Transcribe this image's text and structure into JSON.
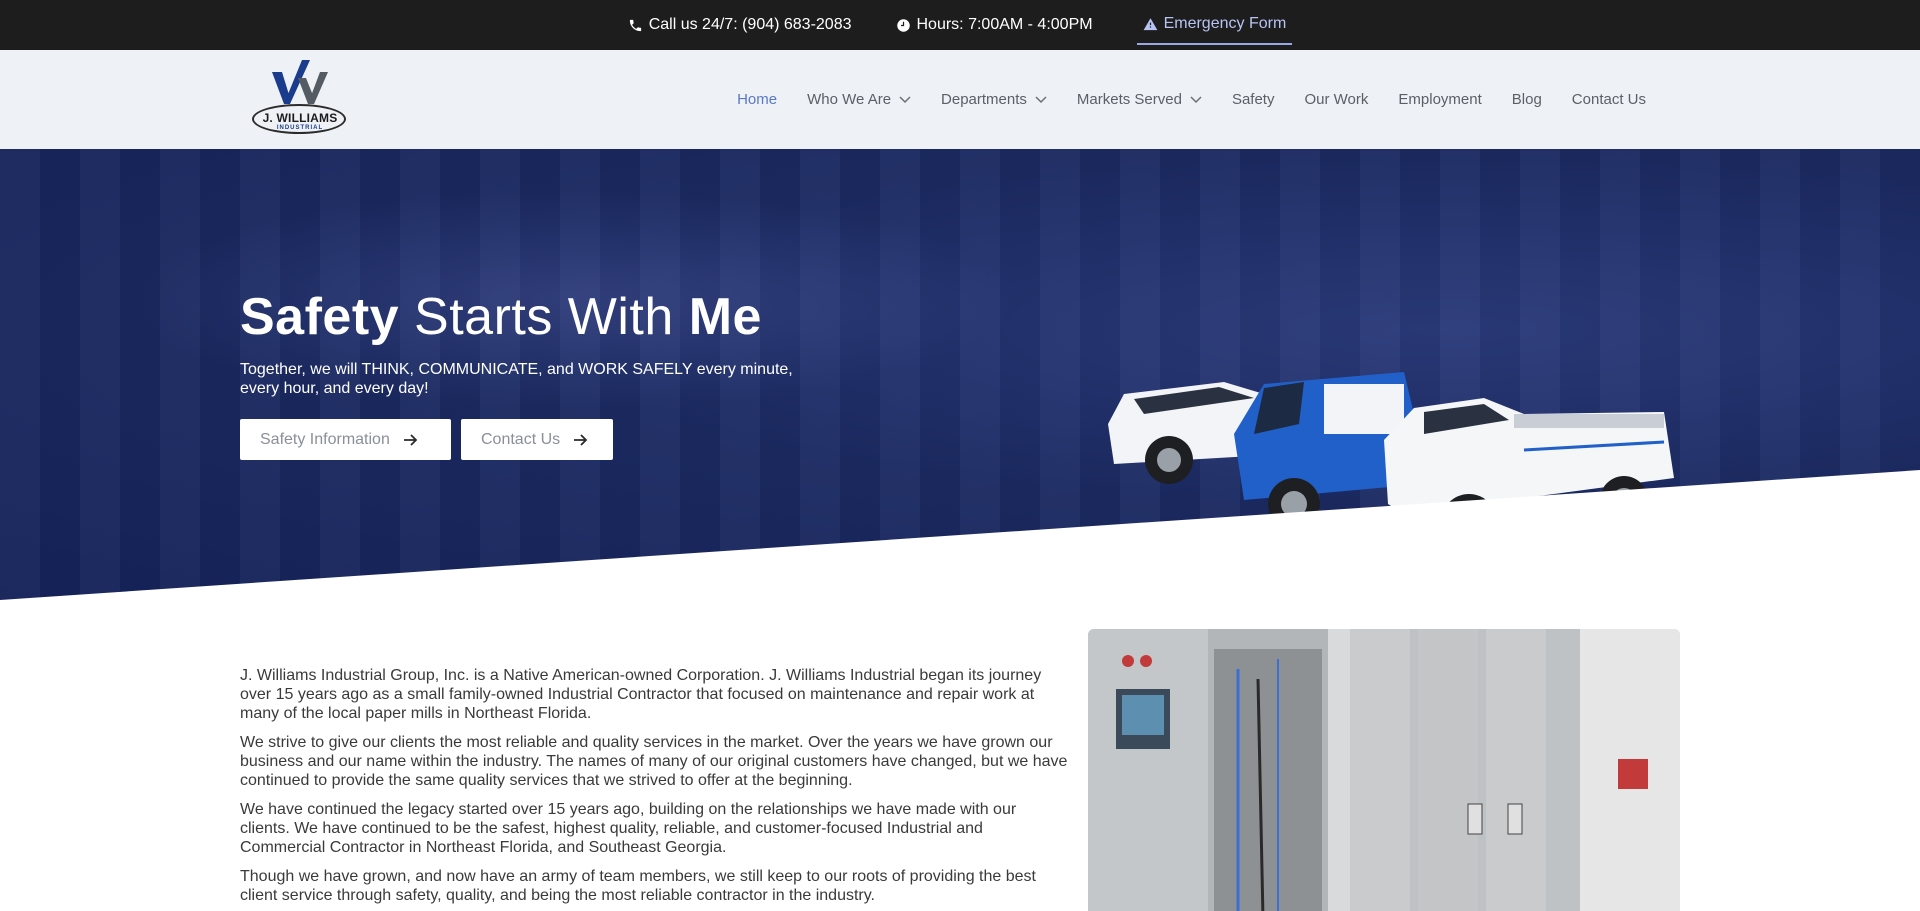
{
  "topbar": {
    "phone": "Call us 24/7: (904) 683-2083",
    "hours": "Hours: 7:00AM - 4:00PM",
    "emergency": "Emergency Form"
  },
  "logo": {
    "name": "J. WILLIAMS",
    "sub": "INDUSTRIAL"
  },
  "nav": {
    "items": [
      {
        "label": "Home",
        "active": true,
        "dropdown": false
      },
      {
        "label": "Who We Are",
        "active": false,
        "dropdown": true
      },
      {
        "label": "Departments",
        "active": false,
        "dropdown": true
      },
      {
        "label": "Markets Served",
        "active": false,
        "dropdown": true
      },
      {
        "label": "Safety",
        "active": false,
        "dropdown": false
      },
      {
        "label": "Our Work",
        "active": false,
        "dropdown": false
      },
      {
        "label": "Employment",
        "active": false,
        "dropdown": false
      },
      {
        "label": "Blog",
        "active": false,
        "dropdown": false
      },
      {
        "label": "Contact Us",
        "active": false,
        "dropdown": false
      }
    ]
  },
  "hero": {
    "title_bold1": "Safety",
    "title_mid": " Starts With ",
    "title_bold2": "Me",
    "tagline": "Together, we will THINK, COMMUNICATE, and WORK SAFELY every minute, every hour, and every day!",
    "btn_safety": "Safety Information",
    "btn_contact": "Contact Us"
  },
  "about": {
    "paragraphs": [
      "J. Williams Industrial Group, Inc. is a Native American-owned Corporation. J. Williams Industrial began its journey over 15 years ago as a small family-owned Industrial Contractor that focused on maintenance and repair work at many of the local paper mills in Northeast Florida.",
      "We strive to give our clients the most reliable and quality services in the market. Over the years we have grown our business and our name within the industry. The names of many of our original customers have changed, but we have continued to provide the same quality services that we strived to offer at the beginning.",
      "We have continued the legacy started over 15 years ago, building on the relationships we have made with our clients. We have continued to be the safest, highest quality, reliable, and customer-focused Industrial and Commercial Contractor in Northeast Florida, and Southeast Georgia.",
      "Though we have grown, and now have an army of team members, we still keep to our roots of providing the best client service through safety, quality, and being the most reliable contractor in the industry."
    ]
  },
  "colors": {
    "topbar": "#1d1d1d",
    "header": "#eef2f7",
    "hero": "#1b2a62",
    "nav_active": "#5a78c8",
    "emergency": "#b7c3f3"
  }
}
